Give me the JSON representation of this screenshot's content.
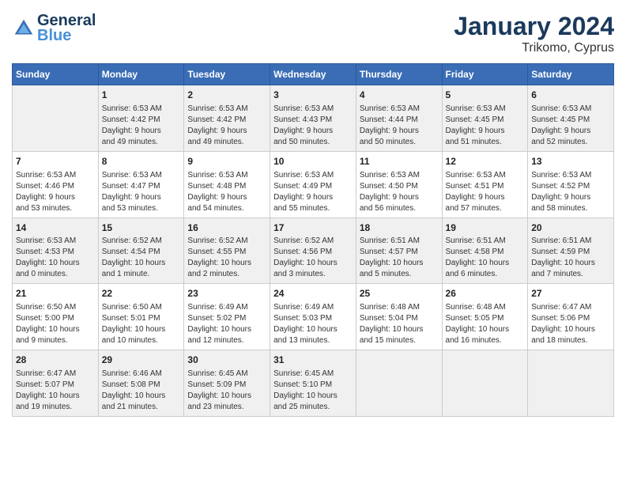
{
  "header": {
    "logo_line1": "General",
    "logo_line2": "Blue",
    "month": "January 2024",
    "location": "Trikomo, Cyprus"
  },
  "weekdays": [
    "Sunday",
    "Monday",
    "Tuesday",
    "Wednesday",
    "Thursday",
    "Friday",
    "Saturday"
  ],
  "weeks": [
    [
      {
        "day": "",
        "info": ""
      },
      {
        "day": "1",
        "info": "Sunrise: 6:53 AM\nSunset: 4:42 PM\nDaylight: 9 hours\nand 49 minutes."
      },
      {
        "day": "2",
        "info": "Sunrise: 6:53 AM\nSunset: 4:42 PM\nDaylight: 9 hours\nand 49 minutes."
      },
      {
        "day": "3",
        "info": "Sunrise: 6:53 AM\nSunset: 4:43 PM\nDaylight: 9 hours\nand 50 minutes."
      },
      {
        "day": "4",
        "info": "Sunrise: 6:53 AM\nSunset: 4:44 PM\nDaylight: 9 hours\nand 50 minutes."
      },
      {
        "day": "5",
        "info": "Sunrise: 6:53 AM\nSunset: 4:45 PM\nDaylight: 9 hours\nand 51 minutes."
      },
      {
        "day": "6",
        "info": "Sunrise: 6:53 AM\nSunset: 4:45 PM\nDaylight: 9 hours\nand 52 minutes."
      }
    ],
    [
      {
        "day": "7",
        "info": "Sunrise: 6:53 AM\nSunset: 4:46 PM\nDaylight: 9 hours\nand 53 minutes."
      },
      {
        "day": "8",
        "info": "Sunrise: 6:53 AM\nSunset: 4:47 PM\nDaylight: 9 hours\nand 53 minutes."
      },
      {
        "day": "9",
        "info": "Sunrise: 6:53 AM\nSunset: 4:48 PM\nDaylight: 9 hours\nand 54 minutes."
      },
      {
        "day": "10",
        "info": "Sunrise: 6:53 AM\nSunset: 4:49 PM\nDaylight: 9 hours\nand 55 minutes."
      },
      {
        "day": "11",
        "info": "Sunrise: 6:53 AM\nSunset: 4:50 PM\nDaylight: 9 hours\nand 56 minutes."
      },
      {
        "day": "12",
        "info": "Sunrise: 6:53 AM\nSunset: 4:51 PM\nDaylight: 9 hours\nand 57 minutes."
      },
      {
        "day": "13",
        "info": "Sunrise: 6:53 AM\nSunset: 4:52 PM\nDaylight: 9 hours\nand 58 minutes."
      }
    ],
    [
      {
        "day": "14",
        "info": "Sunrise: 6:53 AM\nSunset: 4:53 PM\nDaylight: 10 hours\nand 0 minutes."
      },
      {
        "day": "15",
        "info": "Sunrise: 6:52 AM\nSunset: 4:54 PM\nDaylight: 10 hours\nand 1 minute."
      },
      {
        "day": "16",
        "info": "Sunrise: 6:52 AM\nSunset: 4:55 PM\nDaylight: 10 hours\nand 2 minutes."
      },
      {
        "day": "17",
        "info": "Sunrise: 6:52 AM\nSunset: 4:56 PM\nDaylight: 10 hours\nand 3 minutes."
      },
      {
        "day": "18",
        "info": "Sunrise: 6:51 AM\nSunset: 4:57 PM\nDaylight: 10 hours\nand 5 minutes."
      },
      {
        "day": "19",
        "info": "Sunrise: 6:51 AM\nSunset: 4:58 PM\nDaylight: 10 hours\nand 6 minutes."
      },
      {
        "day": "20",
        "info": "Sunrise: 6:51 AM\nSunset: 4:59 PM\nDaylight: 10 hours\nand 7 minutes."
      }
    ],
    [
      {
        "day": "21",
        "info": "Sunrise: 6:50 AM\nSunset: 5:00 PM\nDaylight: 10 hours\nand 9 minutes."
      },
      {
        "day": "22",
        "info": "Sunrise: 6:50 AM\nSunset: 5:01 PM\nDaylight: 10 hours\nand 10 minutes."
      },
      {
        "day": "23",
        "info": "Sunrise: 6:49 AM\nSunset: 5:02 PM\nDaylight: 10 hours\nand 12 minutes."
      },
      {
        "day": "24",
        "info": "Sunrise: 6:49 AM\nSunset: 5:03 PM\nDaylight: 10 hours\nand 13 minutes."
      },
      {
        "day": "25",
        "info": "Sunrise: 6:48 AM\nSunset: 5:04 PM\nDaylight: 10 hours\nand 15 minutes."
      },
      {
        "day": "26",
        "info": "Sunrise: 6:48 AM\nSunset: 5:05 PM\nDaylight: 10 hours\nand 16 minutes."
      },
      {
        "day": "27",
        "info": "Sunrise: 6:47 AM\nSunset: 5:06 PM\nDaylight: 10 hours\nand 18 minutes."
      }
    ],
    [
      {
        "day": "28",
        "info": "Sunrise: 6:47 AM\nSunset: 5:07 PM\nDaylight: 10 hours\nand 19 minutes."
      },
      {
        "day": "29",
        "info": "Sunrise: 6:46 AM\nSunset: 5:08 PM\nDaylight: 10 hours\nand 21 minutes."
      },
      {
        "day": "30",
        "info": "Sunrise: 6:45 AM\nSunset: 5:09 PM\nDaylight: 10 hours\nand 23 minutes."
      },
      {
        "day": "31",
        "info": "Sunrise: 6:45 AM\nSunset: 5:10 PM\nDaylight: 10 hours\nand 25 minutes."
      },
      {
        "day": "",
        "info": ""
      },
      {
        "day": "",
        "info": ""
      },
      {
        "day": "",
        "info": ""
      }
    ]
  ]
}
